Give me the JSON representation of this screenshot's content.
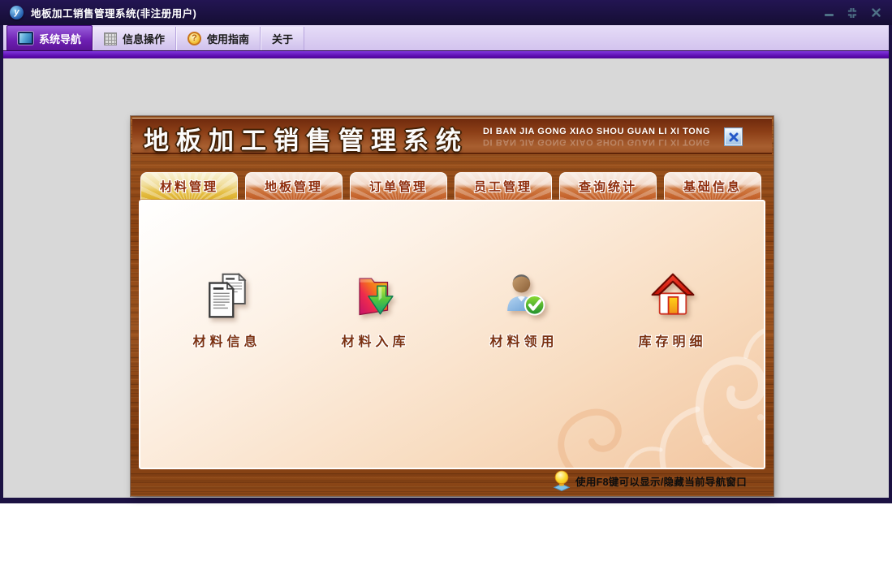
{
  "window": {
    "title": "地板加工销售管理系统(非注册用户)",
    "logo_letter": "y",
    "control_icons": [
      "minimize-icon",
      "restore-icon",
      "close-icon"
    ]
  },
  "menubar": {
    "tabs": [
      {
        "label": "系统导航",
        "icon": "monitor-icon",
        "active": true
      },
      {
        "label": "信息操作",
        "icon": "grid-icon",
        "active": false
      },
      {
        "label": "使用指南",
        "icon": "help-coin-icon",
        "active": false
      },
      {
        "label": "关于",
        "icon": "",
        "active": false
      }
    ]
  },
  "nav_panel": {
    "title": "地板加工销售管理系统",
    "subtitle_pinyin": "DI BAN JIA GONG XIAO SHOU GUAN LI XI TONG",
    "close_icon": "close-icon",
    "tabs": [
      {
        "label": "材料管理",
        "active": true
      },
      {
        "label": "地板管理",
        "active": false
      },
      {
        "label": "订单管理",
        "active": false
      },
      {
        "label": "员工管理",
        "active": false
      },
      {
        "label": "查询统计",
        "active": false
      },
      {
        "label": "基础信息",
        "active": false
      }
    ],
    "items": [
      {
        "label": "材料信息",
        "icon": "documents-icon"
      },
      {
        "label": "材料入库",
        "icon": "folder-import-icon"
      },
      {
        "label": "材料领用",
        "icon": "user-check-icon"
      },
      {
        "label": "库存明细",
        "icon": "house-icon"
      }
    ],
    "footer_icon": "bulb-icon",
    "footer_tip": "使用F8键可以显示/隐藏当前导航窗口"
  },
  "colors": {
    "titlebar_bg": "#171038",
    "menubar_bg": "#d3c3ee",
    "active_menu_tab_purple": "#6d1fb2",
    "divider_purple": "#5a0aad",
    "client_bg": "#d8d8d8",
    "wood_base": "#8c4312",
    "panel_header_brown": "#8d3f17",
    "active_tab_gold": "#e6c14a",
    "inactive_tab_orange": "#c25d26",
    "content_peach": "#f2c6a0",
    "label_maroon": "#7b3111",
    "close_button_blue": "#2458c8"
  }
}
